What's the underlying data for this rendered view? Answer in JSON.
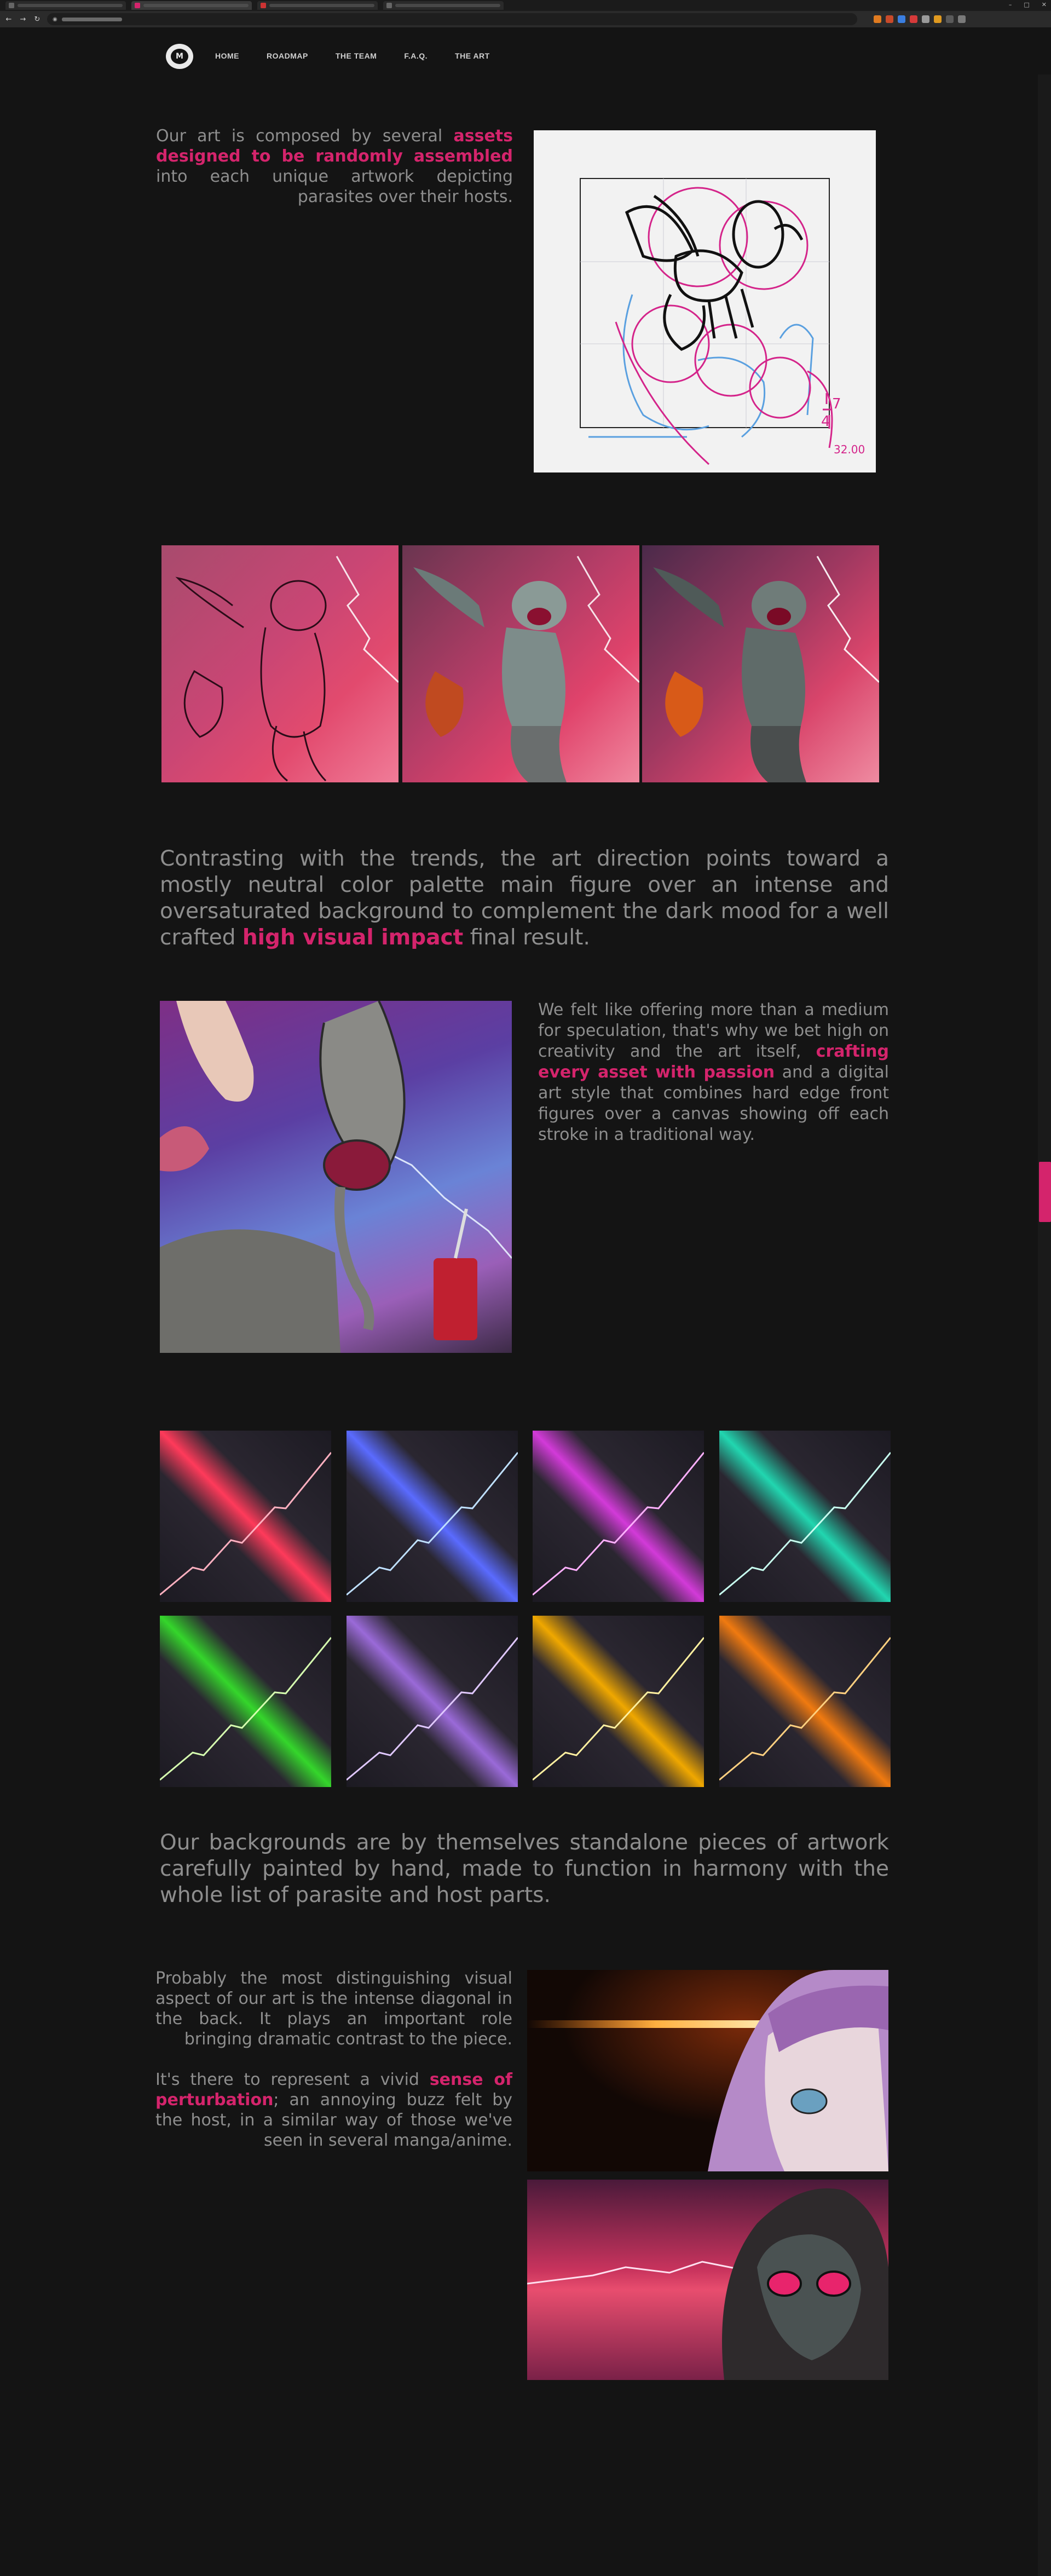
{
  "nav": {
    "logo_glyph": "M",
    "items": [
      "HOME",
      "ROADMAP",
      "THE TEAM",
      "F.A.Q.",
      "THE ART"
    ]
  },
  "section1": {
    "text_before": "Our art is composed by several ",
    "highlight": "assets designed to be randomly assembled",
    "text_after": " into each unique artwork depicting parasites over their hosts.",
    "sketch_notes": [
      "7",
      "4",
      "32.00"
    ]
  },
  "section3": {
    "text_before": "Contrasting with the trends, the art direction points toward a mostly neutral color palette main figure over an intense and oversaturated background to complement the dark mood for a well crafted ",
    "highlight": "high visual impact",
    "text_after": " final result."
  },
  "section4": {
    "text_before": "We felt like offering more than a medium for speculation, that's why we bet high on creativity and the art itself, ",
    "highlight": "crafting every asset with passion",
    "text_after": " and a digital art style that combines hard edge front figures over a canvas showing off each stroke in a traditional way."
  },
  "backgrounds": [
    {
      "name": "red",
      "color": "#ff3a5a",
      "glow": "#ffb0c0"
    },
    {
      "name": "blue",
      "color": "#5a6bff",
      "glow": "#bfe0ff"
    },
    {
      "name": "magenta",
      "color": "#d23ad8",
      "glow": "#ffb0ff"
    },
    {
      "name": "teal",
      "color": "#21d6b0",
      "glow": "#c8fff0"
    },
    {
      "name": "green",
      "color": "#34d62b",
      "glow": "#d6ffb0"
    },
    {
      "name": "violet",
      "color": "#9a6ad8",
      "glow": "#e0c8ff"
    },
    {
      "name": "gold",
      "color": "#f0a800",
      "glow": "#fff0a0"
    },
    {
      "name": "orange",
      "color": "#f07a10",
      "glow": "#ffd080"
    }
  ],
  "section6": {
    "text": "Our backgrounds are by themselves standalone pieces of artwork carefully painted by hand, made to function in harmony with the whole list of parasite and host parts."
  },
  "section7": {
    "para1": "Probably the most distinguishing visual aspect of our art is the intense diagonal in the back. It plays an important role bringing dramatic contrast to the piece.",
    "para2_before": "It's there to represent a vivid ",
    "para2_highlight": "sense of perturbation",
    "para2_after": "; an annoying buzz felt by the host, in a similar way of those we've seen in several manga/anime."
  },
  "colors": {
    "accent": "#d4246c",
    "body_text": "#8e8e8e",
    "background": "#141414"
  }
}
